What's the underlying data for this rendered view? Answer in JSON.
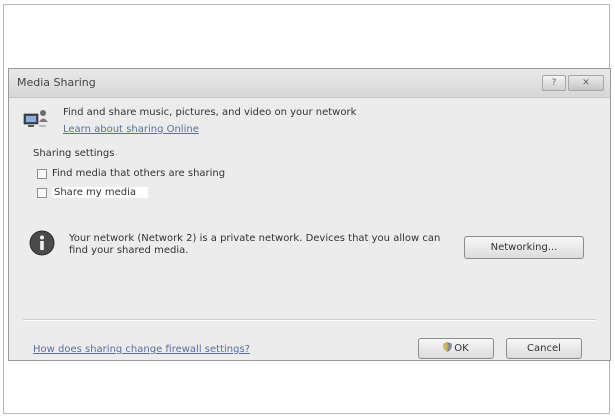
{
  "window": {
    "title": "Media Sharing",
    "help_icon": "help-icon",
    "close_icon": "close-icon"
  },
  "header": {
    "text": "Find and share music, pictures, and video on your network",
    "link": "Learn about sharing Online",
    "icon": "media-sharing-icon"
  },
  "sharing_settings": {
    "label": "Sharing settings",
    "find_media_label": "Find media that others are sharing",
    "find_media_checked": false,
    "share_media_label": "Share my media",
    "share_media_checked": false
  },
  "network_info": {
    "icon": "info-icon",
    "text": "Your network (Network  2) is a private network. Devices that you allow can find your shared media.",
    "networking_button": "Networking..."
  },
  "footer": {
    "firewall_link": "How does sharing change firewall settings?",
    "ok_button": "OK",
    "cancel_button": "Cancel",
    "shield_icon": "uac-shield-icon"
  }
}
